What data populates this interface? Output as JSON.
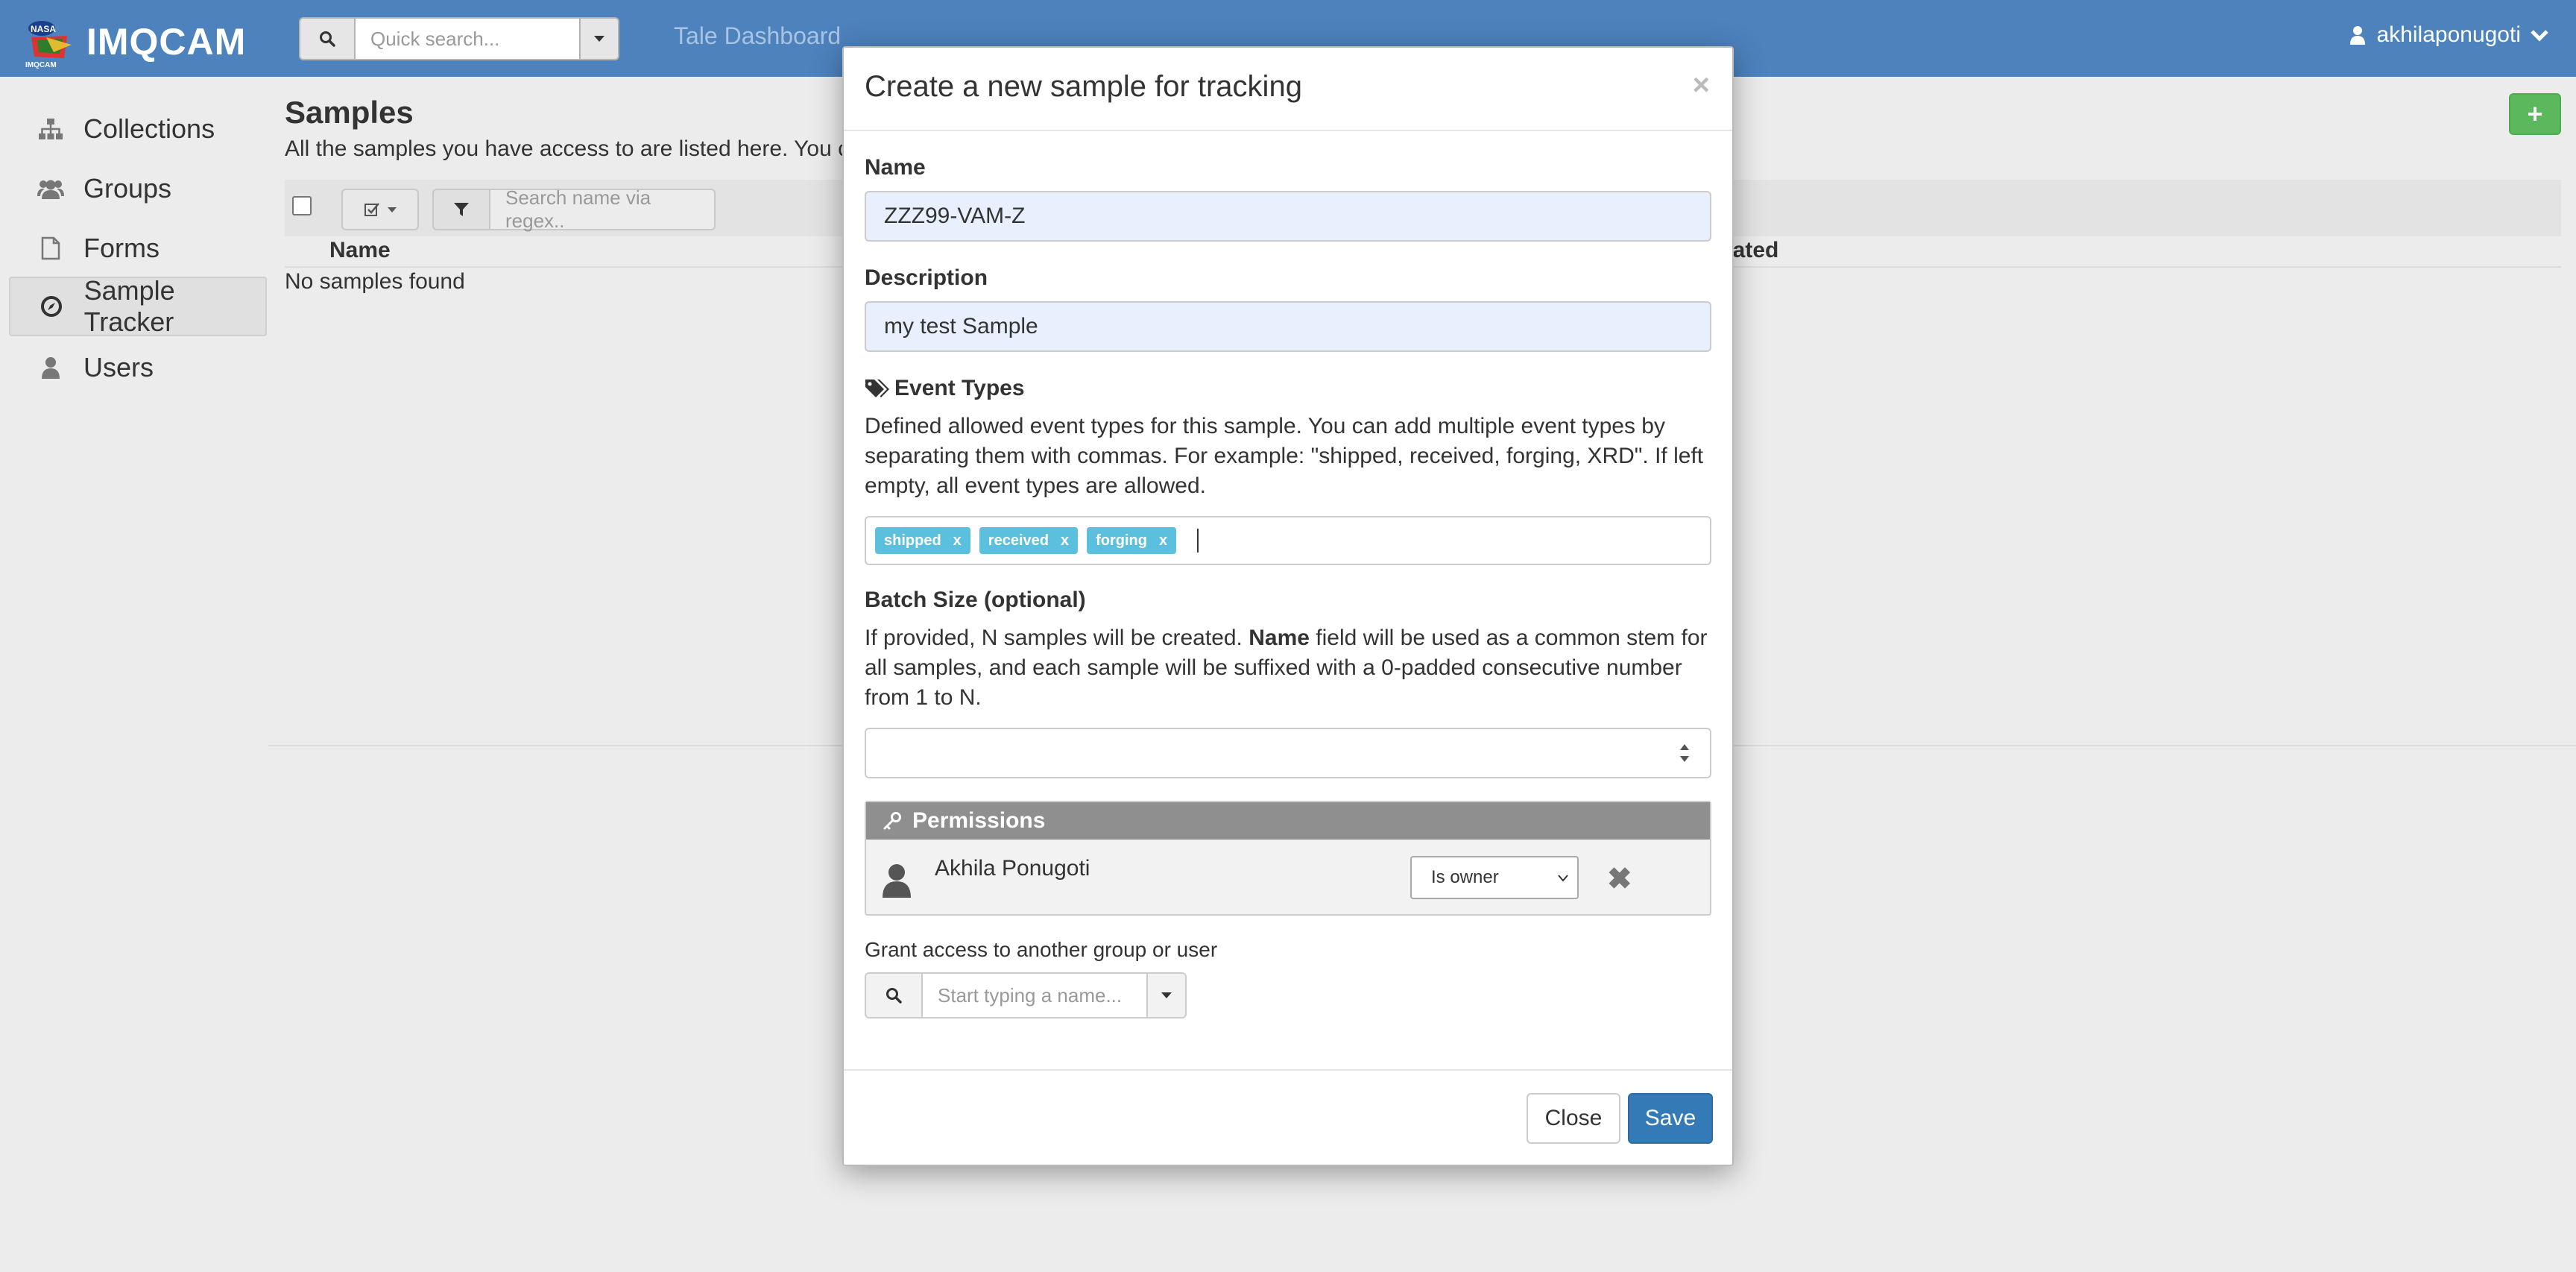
{
  "topbar": {
    "brand_name": "IMQCAM",
    "logo_text": "IMQCAM",
    "search_placeholder": "Quick search...",
    "nav_link": "Tale Dashboard",
    "username": "akhilaponugoti",
    "color": "#4d82bd"
  },
  "sidebar": {
    "items": [
      {
        "label": "Collections",
        "icon": "sitemap-icon"
      },
      {
        "label": "Groups",
        "icon": "users-icon"
      },
      {
        "label": "Forms",
        "icon": "file-icon"
      },
      {
        "label": "Sample Tracker",
        "icon": "compass-icon",
        "active": true
      },
      {
        "label": "Users",
        "icon": "user-icon"
      }
    ]
  },
  "main": {
    "title": "Samples",
    "description": "All the samples you have access to are listed here. You can",
    "add_label": "+",
    "filter_placeholder": "Search name via regex..",
    "columns": [
      "Name",
      "odated"
    ],
    "empty": "No samples found"
  },
  "modal": {
    "title": "Create a new sample for tracking",
    "close_x": "×",
    "name_label": "Name",
    "name_value": "ZZZ99-VAM-Z",
    "desc_label": "Description",
    "desc_value": "my test Sample",
    "events_label": "Event Types",
    "events_help": "Defined allowed event types for this sample. You can add multiple event types by separating them with commas. For example: \"shipped, received, forging, XRD\". If left empty, all event types are allowed.",
    "tags": [
      {
        "label": "shipped",
        "remove": "x"
      },
      {
        "label": "received",
        "remove": "x"
      },
      {
        "label": "forging",
        "remove": "x"
      }
    ],
    "batch_label": "Batch Size (optional)",
    "batch_help_pre": "If provided, N samples will be created. ",
    "batch_help_bold": "Name",
    "batch_help_post": " field will be used as a common stem for all samples, and each sample will be suffixed with a 0-padded consecutive number from 1 to N.",
    "batch_value": "",
    "permissions": {
      "title": "Permissions",
      "user_name": "Akhila Ponugoti",
      "level": "Is owner",
      "remove": "✖"
    },
    "grant_label": "Grant access to another group or user",
    "grant_placeholder": "Start typing a name...",
    "close_label": "Close",
    "save_label": "Save",
    "save_color": "#337ab7"
  }
}
